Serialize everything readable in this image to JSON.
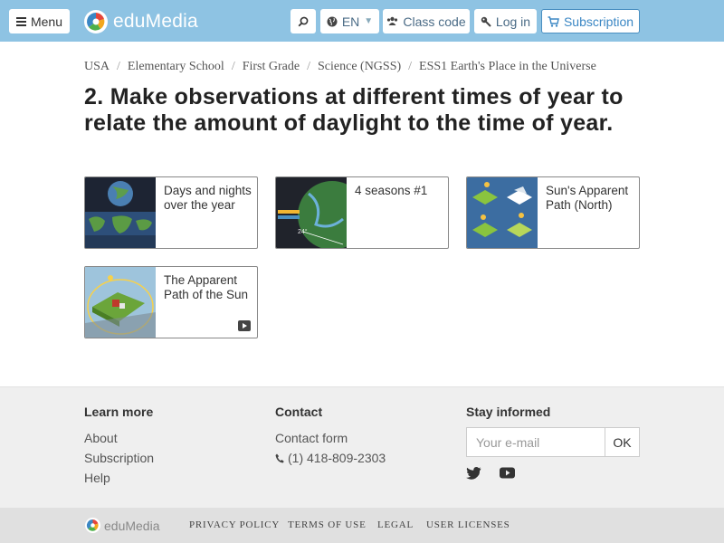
{
  "header": {
    "menu_label": "Menu",
    "brand": "eduMedia",
    "lang_label": "EN",
    "class_code_label": "Class code",
    "login_label": "Log in",
    "subscription_label": "Subscription"
  },
  "breadcrumb": [
    "USA",
    "Elementary School",
    "First Grade",
    "Science (NGSS)",
    "ESS1 Earth's Place in the Universe"
  ],
  "page_title": "2. Make observations at different times of year to relate the amount of daylight to the time of year.",
  "cards": [
    {
      "title": "Days and nights over the year",
      "video": false
    },
    {
      "title": "4 seasons #1",
      "video": false
    },
    {
      "title": "Sun's Apparent Path (North)",
      "video": false
    },
    {
      "title": "The Apparent Path of the Sun",
      "video": true
    }
  ],
  "footer": {
    "learn_more": {
      "heading": "Learn more",
      "links": [
        "About",
        "Subscription",
        "Help"
      ]
    },
    "contact": {
      "heading": "Contact",
      "form_label": "Contact form",
      "phone": "(1) 418-809-2303"
    },
    "stay_informed": {
      "heading": "Stay informed",
      "email_placeholder": "Your e-mail",
      "ok_label": "OK"
    }
  },
  "bottom": {
    "brand": "eduMedia",
    "links": [
      "PRIVACY POLICY",
      "TERMS OF USE",
      "LEGAL",
      "USER LICENSES"
    ]
  },
  "colors": {
    "header_bg": "#8ec3e3",
    "accent": "#3b87c4",
    "footer_bg": "#efefef"
  }
}
